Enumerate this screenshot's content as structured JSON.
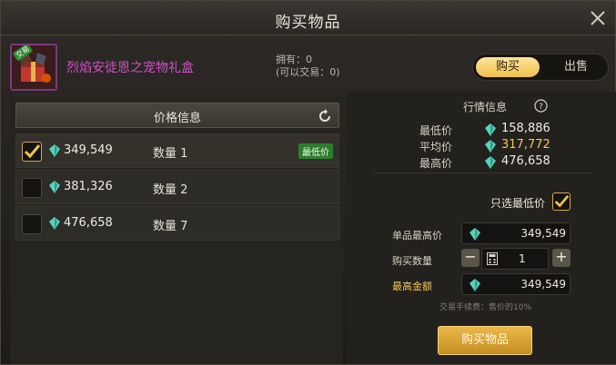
{
  "window": {
    "title": "购买物品"
  },
  "item": {
    "name": "烈焰安徒恩之宠物礼盒",
    "trade_tag": "交易",
    "owned_line": "拥有：0",
    "tradable_line": "(可以交易：0)"
  },
  "mode_toggle": {
    "buy_label": "购买",
    "sell_label": "出售",
    "selected": "购买"
  },
  "price_info": {
    "header": "价格信息",
    "lowest_badge": "最低价",
    "rows": [
      {
        "price": "349,549",
        "quantity": "数量 1",
        "checked": true
      },
      {
        "price": "381,326",
        "quantity": "数量 2",
        "checked": false
      },
      {
        "price": "476,658",
        "quantity": "数量 7",
        "checked": false
      }
    ]
  },
  "market": {
    "title": "行情信息",
    "help_glyph": "?",
    "min_label": "最低价",
    "min_value": "158,886",
    "avg_label": "平均价",
    "avg_value": "317,772",
    "max_label": "最高价",
    "max_value": "476,658"
  },
  "purchase": {
    "only_lowest_label": "只选最低价",
    "only_lowest_checked": true,
    "max_unit_label": "单品最高价",
    "max_unit_value": "349,549",
    "qty_label": "购买数量",
    "qty_value": "1",
    "minus": "−",
    "plus": "+",
    "max_total_label": "最高金额",
    "max_total_value": "349,549",
    "fee_note": "交易手续费：售价的10%",
    "buy_button": "购买物品"
  },
  "colors": {
    "accent_gold": "#f1c04d",
    "item_name_purple": "#d24fc6",
    "gem_teal": "#56d4c0",
    "badge_green": "#2e7d2e"
  }
}
